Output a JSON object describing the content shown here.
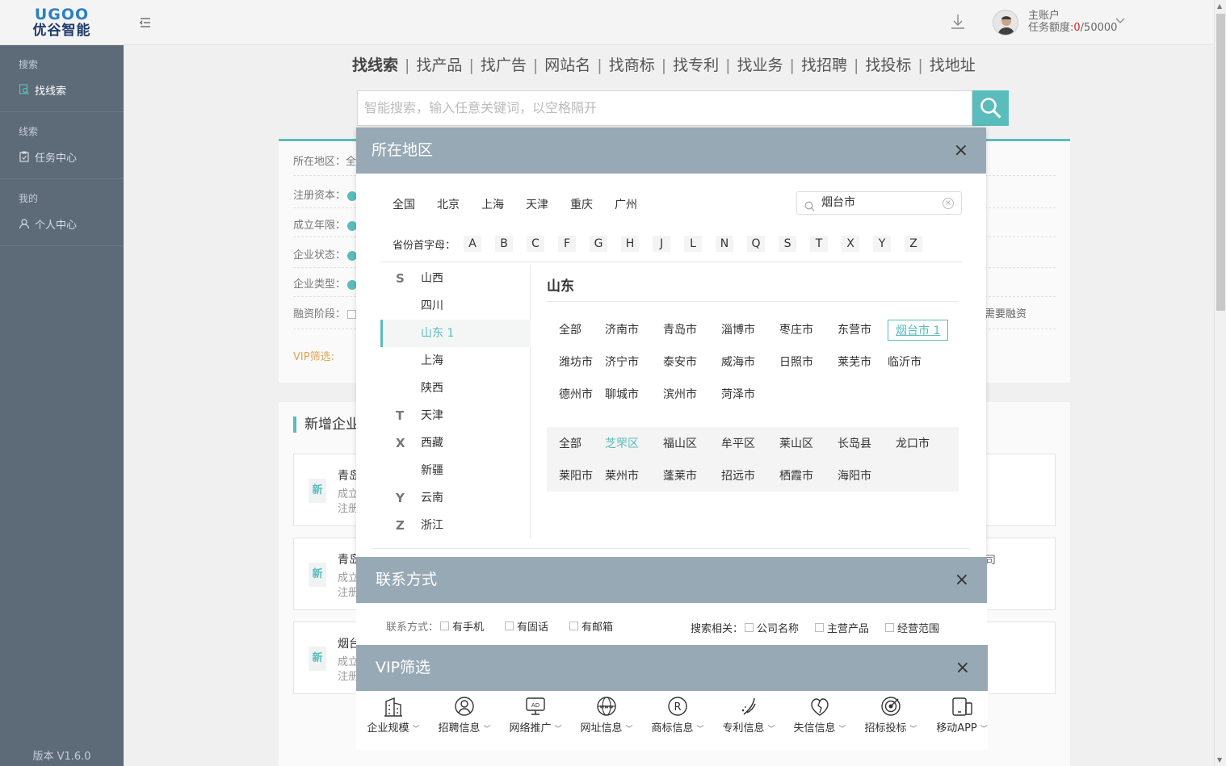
{
  "header": {
    "logo_mark": "UGOO",
    "logo_text": "优谷智能",
    "account_title": "主账户",
    "quota_label": "任务额度:",
    "quota_used": "0",
    "quota_total": "/50000"
  },
  "sidebar": {
    "groups": [
      {
        "head": "搜索",
        "item": "找线索"
      },
      {
        "head": "线索",
        "item": "任务中心"
      },
      {
        "head": "我的",
        "item": "个人中心"
      }
    ],
    "version": "版本 V1.6.0"
  },
  "nav_tabs": [
    "找线索",
    "找产品",
    "找广告",
    "网站名",
    "找商标",
    "找专利",
    "找业务",
    "找招聘",
    "找投标",
    "找地址"
  ],
  "search": {
    "placeholder": "智能搜索，输入任意关键词，以空格隔开"
  },
  "filters": {
    "region": "所在地区：全",
    "capital": "注册资本：",
    "years": "成立年限：",
    "status": "企业状态：",
    "type": "企业类型：",
    "financing": "融资阶段：",
    "vip": "VIP筛选:",
    "need_financing": "需要融资"
  },
  "list": {
    "title": "新增企业",
    "cards": [
      {
        "badge": "新",
        "name": "青岛",
        "l1": "成立",
        "l2": "注册"
      },
      {
        "badge": "新",
        "name": "青岛",
        "l1": "成立",
        "l2": "注册"
      },
      {
        "badge": "新",
        "name": "烟台",
        "l1": "成立",
        "l2": "注册"
      }
    ],
    "right_fragment": "司"
  },
  "region_modal": {
    "title": "所在地区",
    "close": "×",
    "quick_cities": [
      "全国",
      "北京",
      "上海",
      "天津",
      "重庆",
      "广州"
    ],
    "search_value": "烟台市",
    "letters_label": "省份首字母：",
    "letters": [
      "A",
      "B",
      "C",
      "F",
      "G",
      "H",
      "J",
      "L",
      "N",
      "Q",
      "S",
      "T",
      "X",
      "Y",
      "Z"
    ],
    "provinces": [
      {
        "initial": "S",
        "name": "山西"
      },
      {
        "initial": "",
        "name": "四川"
      },
      {
        "initial": "",
        "name": "山东  1",
        "active": true
      },
      {
        "initial": "",
        "name": "上海"
      },
      {
        "initial": "",
        "name": "陕西"
      },
      {
        "initial": "T",
        "name": "天津"
      },
      {
        "initial": "X",
        "name": "西藏"
      },
      {
        "initial": "",
        "name": "新疆"
      },
      {
        "initial": "Y",
        "name": "云南"
      },
      {
        "initial": "Z",
        "name": "浙江"
      }
    ],
    "province_title": "山东",
    "cities": [
      "全部",
      "济南市",
      "青岛市",
      "淄博市",
      "枣庄市",
      "东营市",
      "烟台市 1",
      "潍坊市",
      "济宁市",
      "泰安市",
      "威海市",
      "日照市",
      "莱芜市",
      "临沂市",
      "德州市",
      "聊城市",
      "滨州市",
      "菏泽市"
    ],
    "districts": [
      "全部",
      "芝罘区",
      "福山区",
      "牟平区",
      "莱山区",
      "长岛县",
      "龙口市",
      "莱阳市",
      "莱州市",
      "蓬莱市",
      "招远市",
      "栖霞市",
      "海阳市"
    ]
  },
  "contact_modal": {
    "title": "联系方式",
    "close": "×",
    "label": "联系方式：",
    "options": [
      "有手机",
      "有固话",
      "有邮箱"
    ],
    "search_label": "搜索相关：",
    "search_options": [
      "公司名称",
      "主营产品",
      "经营范围"
    ]
  },
  "vip_modal": {
    "title": "VIP筛选",
    "close": "×",
    "items": [
      {
        "label": "企业规模",
        "icon": "building-icon"
      },
      {
        "label": "招聘信息",
        "icon": "person-icon"
      },
      {
        "label": "网络推广",
        "icon": "ad-icon"
      },
      {
        "label": "网址信息",
        "icon": "www-icon"
      },
      {
        "label": "商标信息",
        "icon": "trademark-icon"
      },
      {
        "label": "专利信息",
        "icon": "patent-icon"
      },
      {
        "label": "失信信息",
        "icon": "broken-heart-icon"
      },
      {
        "label": "招标投标",
        "icon": "target-icon"
      },
      {
        "label": "移动APP",
        "icon": "mobile-icon"
      }
    ]
  },
  "colors": {
    "accent": "#5bbcbc",
    "modal_head": "#97a9b5",
    "sidebar": "#5d6a78",
    "quota_used": "#e02020",
    "vip": "#e2a455"
  }
}
